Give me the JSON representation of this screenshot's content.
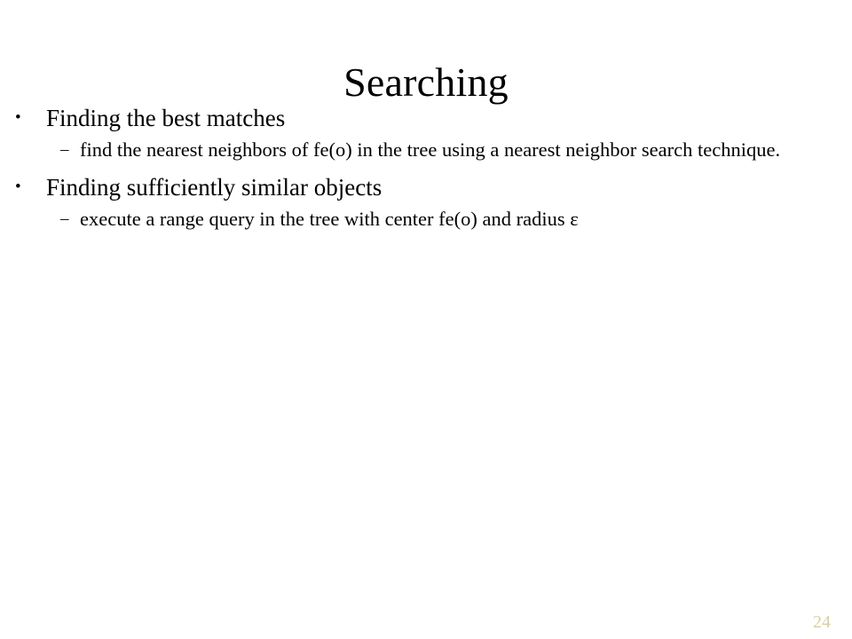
{
  "slide": {
    "title": "Searching",
    "page_number": "24",
    "page_number_color": "#d9d0a2",
    "background_color": "#ffffff",
    "text_color": "#000000",
    "bullet_marker": "•",
    "sub_bullet_marker": "–",
    "content": [
      {
        "level": 1,
        "text": "Finding the best matches"
      },
      {
        "level": 2,
        "text": "find the nearest neighbors of fe(o) in the tree using a nearest neighbor search technique."
      },
      {
        "level": 1,
        "text": "Finding sufficiently similar objects"
      },
      {
        "level": 2,
        "text": "execute a range query in the tree with center fe(o) and radius ε"
      }
    ]
  }
}
